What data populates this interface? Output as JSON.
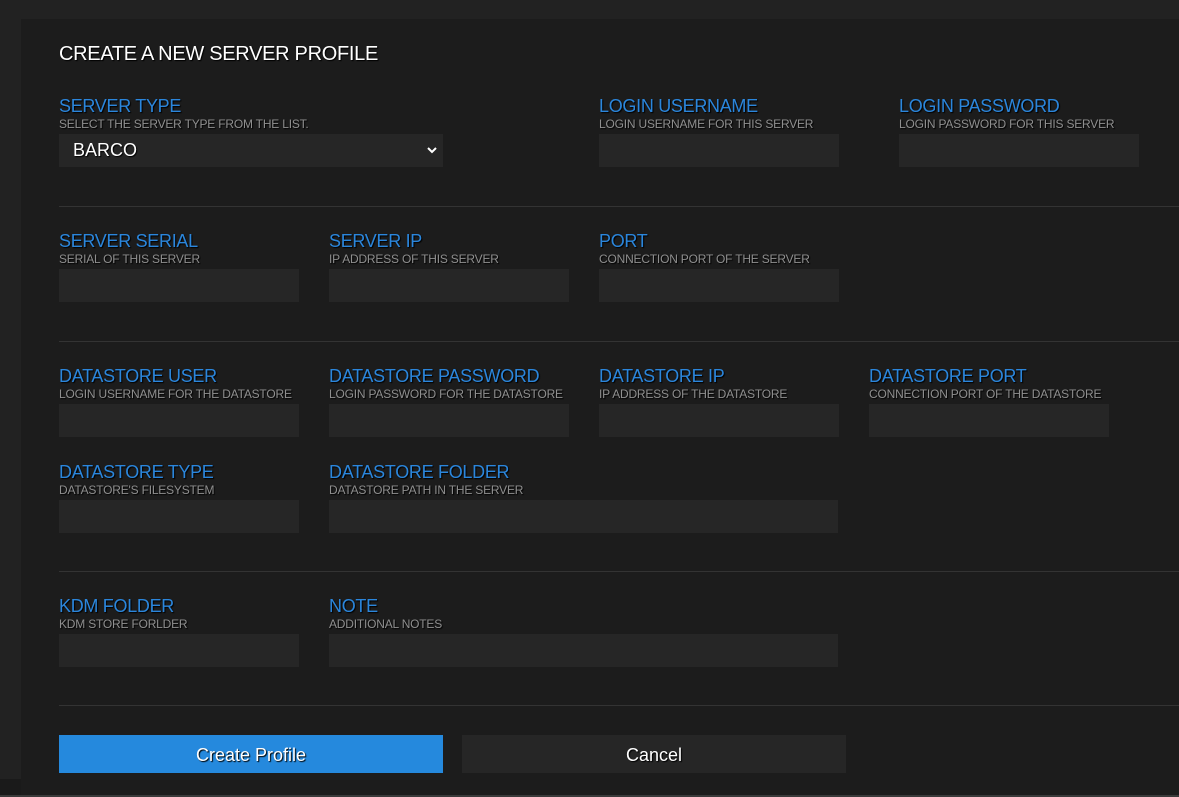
{
  "dialog": {
    "title": "CREATE A NEW SERVER PROFILE"
  },
  "fields": {
    "server_type": {
      "label": "SERVER TYPE",
      "description": "SELECT THE SERVER TYPE FROM THE LIST.",
      "selected": "BARCO"
    },
    "login_username": {
      "label": "LOGIN USERNAME",
      "description": "LOGIN USERNAME FOR THIS SERVER",
      "value": ""
    },
    "login_password": {
      "label": "LOGIN PASSWORD",
      "description": "LOGIN PASSWORD FOR THIS SERVER",
      "value": ""
    },
    "server_serial": {
      "label": "SERVER SERIAL",
      "description": "SERIAL OF THIS SERVER",
      "value": ""
    },
    "server_ip": {
      "label": "SERVER IP",
      "description": "IP ADDRESS OF THIS SERVER",
      "value": ""
    },
    "port": {
      "label": "PORT",
      "description": "CONNECTION PORT OF THE SERVER",
      "value": ""
    },
    "datastore_user": {
      "label": "DATASTORE USER",
      "description": "LOGIN USERNAME FOR THE DATASTORE",
      "value": ""
    },
    "datastore_password": {
      "label": "DATASTORE PASSWORD",
      "description": "LOGIN PASSWORD FOR THE DATASTORE",
      "value": ""
    },
    "datastore_ip": {
      "label": "DATASTORE IP",
      "description": "IP ADDRESS OF THE DATASTORE",
      "value": ""
    },
    "datastore_port": {
      "label": "DATASTORE PORT",
      "description": "CONNECTION PORT OF THE DATASTORE",
      "value": ""
    },
    "datastore_type": {
      "label": "DATASTORE TYPE",
      "description": "DATASTORE'S FILESYSTEM",
      "value": ""
    },
    "datastore_folder": {
      "label": "DATASTORE FOLDER",
      "description": "DATASTORE PATH IN THE SERVER",
      "value": ""
    },
    "kdm_folder": {
      "label": "KDM FOLDER",
      "description": "KDM STORE FORLDER",
      "value": ""
    },
    "note": {
      "label": "NOTE",
      "description": "ADDITIONAL NOTES",
      "value": ""
    }
  },
  "actions": {
    "create_label": "Create Profile",
    "cancel_label": "Cancel"
  },
  "colors": {
    "accent": "#2589dd",
    "label_blue": "#2b86dc",
    "panel_bg": "#1c1c1c",
    "input_bg": "#262626"
  },
  "icons": {
    "select_chevron": "chevron-down-icon"
  }
}
